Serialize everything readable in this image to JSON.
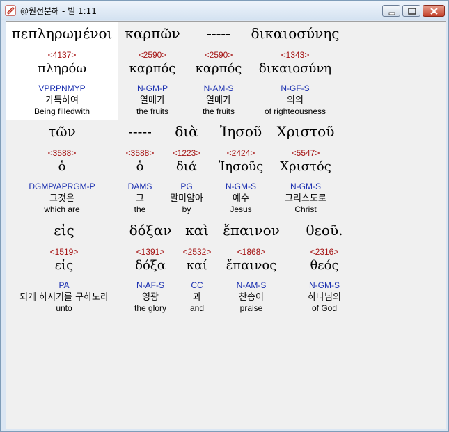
{
  "window": {
    "title": "@원전분해 - 빌 1:11",
    "icon": "app-logo-icon",
    "controls": [
      "minimize-icon",
      "maximize-icon",
      "close-icon"
    ],
    "selected_color": "#ffffff"
  },
  "rows": [
    {
      "words": [
        {
          "greek": "πεπληρωμένοι",
          "strong": "<4137>",
          "lemma": "πληρόω",
          "parse": "VPRPNMYP",
          "korean": "가득하여",
          "english": "Being filledwith"
        },
        {
          "greek": "καρπῶν",
          "strong": "<2590>",
          "lemma": "καρπός",
          "parse": "N-GM-P",
          "korean": "열매가",
          "english": "the fruits"
        },
        {
          "greek": "-----",
          "strong": "<2590>",
          "lemma": "καρπός",
          "parse": "N-AM-S",
          "korean": "열매가",
          "english": "the fruits"
        },
        {
          "greek": "δικαιοσύνης",
          "strong": "<1343>",
          "lemma": "δικαιοσύνη",
          "parse": "N-GF-S",
          "korean": "의의",
          "english": "of righteousness"
        }
      ]
    },
    {
      "words": [
        {
          "greek": "τῶν",
          "strong": "<3588>",
          "lemma": "ὁ",
          "parse": "DGMP/APRGM-P",
          "korean": "그것은",
          "english": "which are"
        },
        {
          "greek": "-----",
          "strong": "<3588>",
          "lemma": "ὁ",
          "parse": "DAMS",
          "korean": "그",
          "english": "the"
        },
        {
          "greek": "διὰ",
          "strong": "<1223>",
          "lemma": "διά",
          "parse": "PG",
          "korean": "말미암아",
          "english": "by"
        },
        {
          "greek": "Ἰησοῦ",
          "strong": "<2424>",
          "lemma": "Ἰησοῦς",
          "parse": "N-GM-S",
          "korean": "예수",
          "english": "Jesus"
        },
        {
          "greek": "Χριστοῦ",
          "strong": "<5547>",
          "lemma": "Χριστός",
          "parse": "N-GM-S",
          "korean": "그리스도로",
          "english": "Christ"
        }
      ]
    },
    {
      "words": [
        {
          "greek": "εἰς",
          "strong": "<1519>",
          "lemma": "εἰς",
          "parse": "PA",
          "korean": "되게 하시기를 구하노라",
          "english": "unto"
        },
        {
          "greek": "δόξαν",
          "strong": "<1391>",
          "lemma": "δόξα",
          "parse": "N-AF-S",
          "korean": "영광",
          "english": "the glory"
        },
        {
          "greek": "καὶ",
          "strong": "<2532>",
          "lemma": "καί",
          "parse": "CC",
          "korean": "과",
          "english": "and"
        },
        {
          "greek": "ἔπαινον",
          "strong": "<1868>",
          "lemma": "ἔπαινος",
          "parse": "N-AM-S",
          "korean": "찬송이",
          "english": "praise"
        },
        {
          "greek": "θεοῦ.",
          "strong": "<2316>",
          "lemma": "θεός",
          "parse": "N-GM-S",
          "korean": "하나님의",
          "english": "of God"
        }
      ]
    }
  ]
}
